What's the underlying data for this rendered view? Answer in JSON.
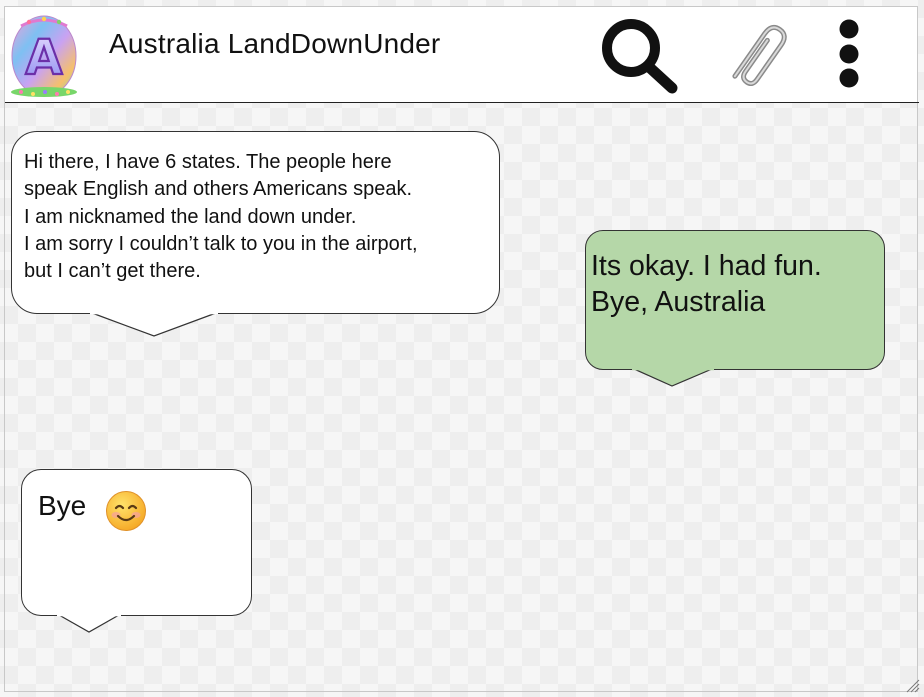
{
  "header": {
    "title": "Australia LandDownUnder",
    "avatar_letter": "A",
    "icons": [
      "search-icon",
      "paperclip-icon",
      "more-vertical-icon"
    ]
  },
  "messages": [
    {
      "from": "contact",
      "text": "Hi there, I have 6 states. The people here\nspeak  English and others Americans speak.\nI am nicknamed the land down under.\nI am sorry I couldn’t talk to you in the airport,\nbut I can’t get there."
    },
    {
      "from": "me",
      "text": "Its okay. I had fun.\nBye, Australia"
    },
    {
      "from": "contact",
      "text": "Bye",
      "emoji": "smiling-face-icon"
    }
  ],
  "colors": {
    "outgoing_bubble": "#b5d7a8",
    "incoming_bubble": "#ffffff",
    "outline": "#333333"
  }
}
